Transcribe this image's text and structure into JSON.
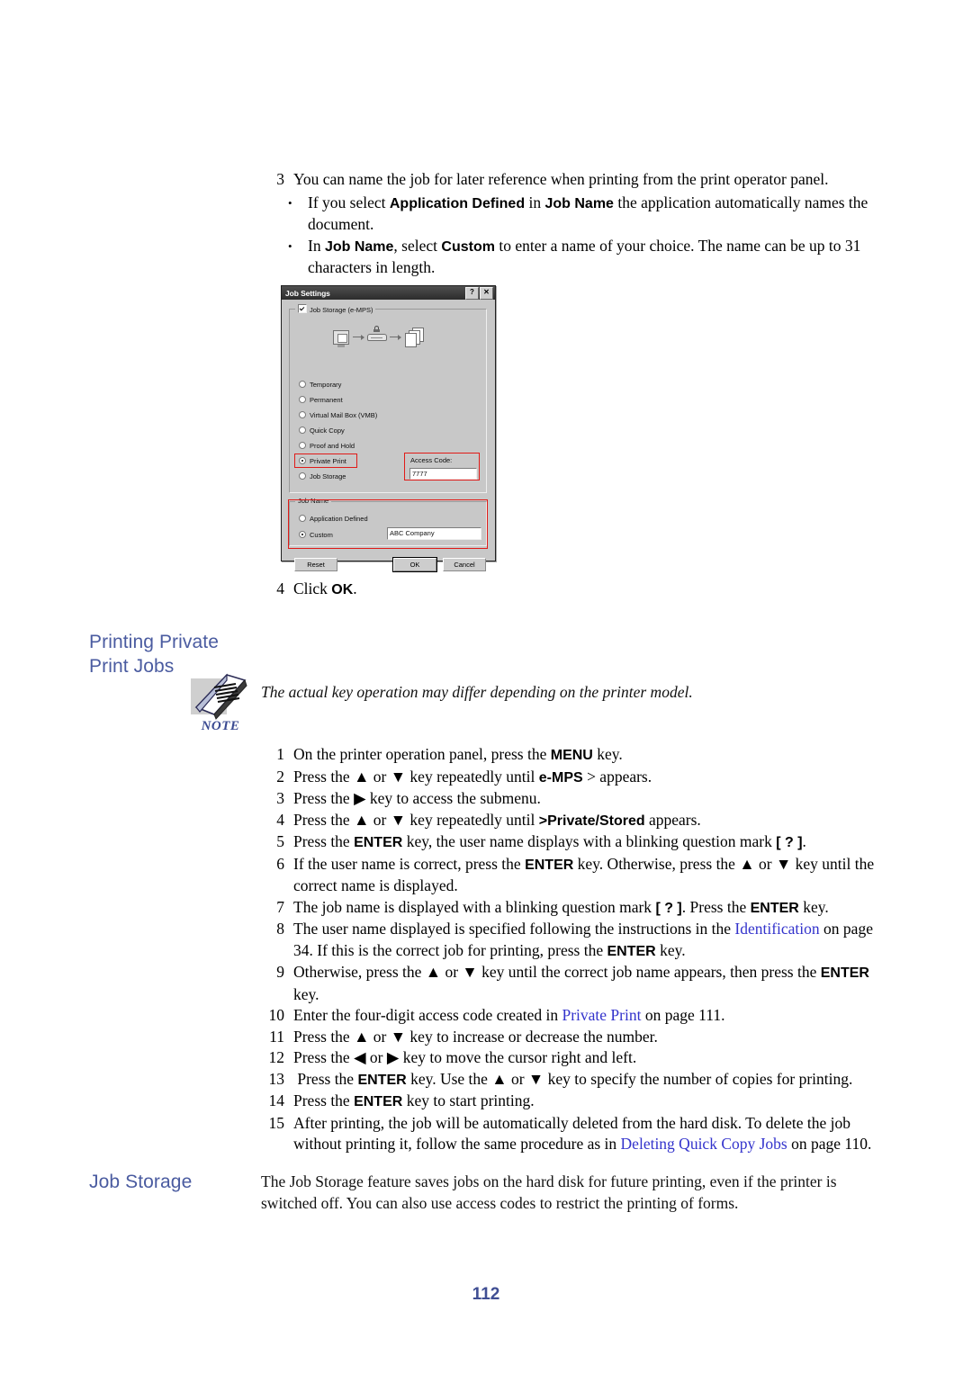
{
  "document": {
    "page_number": "112",
    "heading_color": "#4a5ba0",
    "link_color": "#3333cc"
  },
  "top_section": {
    "step3": {
      "num": "3",
      "text_plain": "You can name the job for later reference when printing from the print operator panel."
    },
    "bullets": [
      {
        "bullet": "•"
      },
      {
        "bullet": "•"
      }
    ],
    "bullet1_pre": "If you select ",
    "bullet1_b1": "Application Defined",
    "bullet1_mid": " in ",
    "bullet1_b2": "Job Name",
    "bullet1_post": " the application automatically names the document.",
    "bullet2_pre": "In ",
    "bullet2_b1": "Job Name",
    "bullet2_mid": ", select ",
    "bullet2_b2": "Custom",
    "bullet2_post": " to enter a name of your choice. The name can be up to 31 characters in length.",
    "step4": {
      "num": "4",
      "pre": "Click ",
      "bold": "OK",
      "post": "."
    }
  },
  "dialog": {
    "title": "Job Settings",
    "help_button": "?",
    "close_button": "✕",
    "storage_group_label": "Job Storage (e-MPS)",
    "storage_checked": true,
    "options": [
      {
        "label": "Temporary",
        "selected": false
      },
      {
        "label": "Permanent",
        "selected": false
      },
      {
        "label": "Virtual Mail Box (VMB)",
        "selected": false
      },
      {
        "label": "Quick Copy",
        "selected": false
      },
      {
        "label": "Proof and Hold",
        "selected": false
      },
      {
        "label": "Private Print",
        "selected": true
      },
      {
        "label": "Job Storage",
        "selected": false
      }
    ],
    "access_code_label": "Access Code:",
    "access_code_value": "7777",
    "job_name_group_label": "Job Name",
    "job_name_options": [
      {
        "label": "Application Defined",
        "selected": false
      },
      {
        "label": "Custom",
        "selected": true
      }
    ],
    "job_name_value": "ABC Company",
    "buttons": {
      "reset": "Reset",
      "ok": "OK",
      "cancel": "Cancel"
    },
    "highlight_color": "#e01b18"
  },
  "private_section": {
    "heading_line1": "Printing Private",
    "heading_line2": "Print Jobs",
    "note_word": "NOTE",
    "note_text": "The actual key operation may differ depending on the printer model.",
    "steps": [
      {
        "num": "1",
        "text": "On the printer operation panel, press the MENU key."
      },
      {
        "num": "2",
        "text": "Press the ▲ or ▼ key repeatedly until e-MPS > appears."
      },
      {
        "num": "3",
        "text": "Press the ▶ key to access the submenu."
      },
      {
        "num": "4",
        "text": "Press the ▲ or ▼ key repeatedly until >Private/Stored appears."
      },
      {
        "num": "5",
        "text": "Press the ENTER key, the user name displays with a blinking question mark [ ? ]."
      },
      {
        "num": "6",
        "text": "If the user name is correct, press the ENTER key. Otherwise, press the ▲ or ▼ key until the correct name is displayed."
      },
      {
        "num": "7",
        "text": "The job name is displayed with a blinking question mark [ ? ]. Press the ENTER key."
      },
      {
        "num": "8",
        "text": "The user name displayed is specified following the instructions in the Identification on page 34. If this is the correct job for printing, press the ENTER key."
      },
      {
        "num": "9",
        "text": "Otherwise, press the ▲ or ▼ key until the correct job name appears, then press the ENTER key."
      },
      {
        "num": "10",
        "text": "Enter the four-digit access code created in Private Print on page 111."
      },
      {
        "num": "11",
        "text": "Press the ▲ or ▼ key to increase or decrease the number."
      },
      {
        "num": "12",
        "text": "Press the ◀ or ▶ key to move the cursor right and left."
      },
      {
        "num": "13",
        "text": "Press the ENTER key. Use the ▲ or ▼ key to specify the number of copies for printing."
      },
      {
        "num": "14",
        "text": "Press the ENTER key to start printing."
      },
      {
        "num": "15",
        "text": "After printing, the job will be automatically deleted from the hard disk. To delete the job without printing it, follow the same procedure as in Deleting Quick Copy Jobs on page 110."
      }
    ],
    "link_identification": "Identification",
    "link_private_print": "Private Print",
    "link_deleting_quick_copy": "Deleting Quick Copy Jobs"
  },
  "job_storage_section": {
    "heading": "Job Storage",
    "paragraph": "The Job Storage feature saves jobs on the hard disk for future printing, even if the printer is switched off. You can also use access codes to restrict the printing of forms."
  }
}
